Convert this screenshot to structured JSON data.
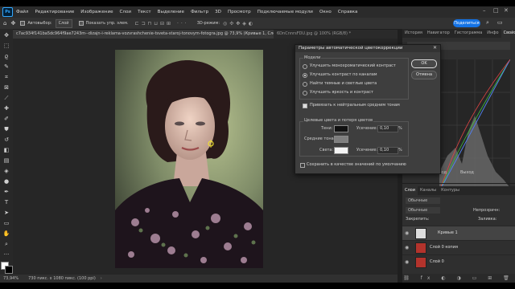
{
  "app": {
    "logo": "Ps"
  },
  "menu": [
    "Файл",
    "Редактирование",
    "Изображение",
    "Слои",
    "Текст",
    "Выделение",
    "Фильтр",
    "3D",
    "Просмотр",
    "Подключаемые модули",
    "Окно",
    "Справка"
  ],
  "options": {
    "auto_select": "Автовыбор:",
    "layer_dropdown": "Слой",
    "transform_controls": "Показать упр. элем.",
    "three_d": "3D-режим:",
    "share": "Поделиться"
  },
  "tabs": [
    {
      "label": "c7ac934f141ba5dc964f9ae7243m--dizajn-i-reklama-vozvrashchenie-tsveta-staroj-tonovym-fotogra.jpg @ 73,9% (Кривые 1, Слой-маска/8) *",
      "active": true
    },
    {
      "label": "6DnCnnrsFDU.jpg @ 100% (RGB/8) *",
      "active": false
    }
  ],
  "status": {
    "zoom": "73,94%",
    "info": "730 пикс. x 1080 пикс. (100 ppi)"
  },
  "panel_tabs": [
    "История",
    "Навигатор",
    "Гистограмма",
    "Инфо",
    "Свойства"
  ],
  "properties": {
    "in_label": "Вход",
    "out_label": "Выход"
  },
  "layers_tabs": [
    "Слои",
    "Каналы",
    "Контуры"
  ],
  "layers": {
    "search": "Обычные",
    "blend": "Обычные",
    "opacity_label": "Непрозрачн:",
    "fill_label": "Заливка:",
    "lock_label": "Закрепить:",
    "items": [
      {
        "name": "Кривые 1",
        "selected": true
      },
      {
        "name": "Слой 0 копия",
        "selected": false
      },
      {
        "name": "Слой 0",
        "selected": false
      }
    ]
  },
  "dialog": {
    "title": "Параметры автоматической цветокоррекции",
    "algorithms_label": "Модели",
    "options": [
      {
        "label": "Улучшить монохроматический контраст",
        "selected": false
      },
      {
        "label": "Улучшить контраст по каналам",
        "selected": true
      },
      {
        "label": "Найти темные и светлые цвета",
        "selected": false
      },
      {
        "label": "Улучшить яркость и контраст",
        "selected": false
      }
    ],
    "snap_label": "Привязать к нейтральным средним тонам",
    "targets_label": "Целевые цвета и потеря цветов",
    "shadows": {
      "label": "Тени:",
      "clip_label": "Усечение:",
      "clip": "0,10",
      "unit": "%",
      "color": "#111111"
    },
    "midtones": {
      "label": "Средние тона:",
      "color": "#7f7f7f"
    },
    "highlights": {
      "label": "Света:",
      "clip_label": "Усечение:",
      "clip": "0,10",
      "unit": "%",
      "color": "#f4f4f4"
    },
    "save_default": "Сохранить в качестве значений по умолчанию",
    "ok": "OK",
    "cancel": "Отмена"
  }
}
